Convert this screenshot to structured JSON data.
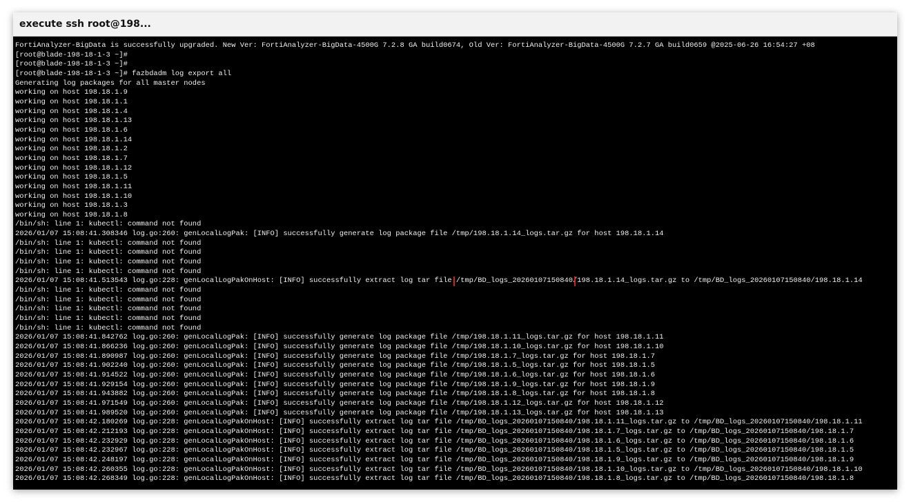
{
  "window": {
    "title": "execute ssh root@198..."
  },
  "terminal": {
    "lines": [
      "FortiAnalyzer-BigData is successfully upgraded. New Ver: FortiAnalyzer-BigData-4500G 7.2.8 GA build0674, Old Ver: FortiAnalyzer-BigData-4500G 7.2.7 GA build0659 @2025-06-26 16:54:27 +08",
      "[root@blade-198-18-1-3 ~]#",
      "[root@blade-198-18-1-3 ~]#",
      "[root@blade-198-18-1-3 ~]# fazbdadm log export all",
      "Generating log packages for all master nodes",
      "working on host 198.18.1.9",
      "working on host 198.18.1.1",
      "working on host 198.18.1.4",
      "working on host 198.18.1.13",
      "working on host 198.18.1.6",
      "working on host 198.18.1.14",
      "working on host 198.18.1.2",
      "working on host 198.18.1.7",
      "working on host 198.18.1.12",
      "working on host 198.18.1.5",
      "working on host 198.18.1.11",
      "working on host 198.18.1.10",
      "working on host 198.18.1.3",
      "working on host 198.18.1.8",
      "/bin/sh: line 1: kubectl: command not found",
      "2026/01/07 15:08:41.308346 log.go:260: genLocalLogPak: [INFO] successfully generate log package file /tmp/198.18.1.14_logs.tar.gz for host 198.18.1.14",
      "/bin/sh: line 1: kubectl: command not found",
      "/bin/sh: line 1: kubectl: command not found",
      "/bin/sh: line 1: kubectl: command not found",
      "/bin/sh: line 1: kubectl: command not found",
      "/bin/sh: line 1: kubectl: command not found",
      "/bin/sh: line 1: kubectl: command not found",
      "/bin/sh: line 1: kubectl: command not found",
      "/bin/sh: line 1: kubectl: command not found",
      "/bin/sh: line 1: kubectl: command not found",
      "2026/01/07 15:08:41.842762 log.go:260: genLocalLogPak: [INFO] successfully generate log package file /tmp/198.18.1.11_logs.tar.gz for host 198.18.1.11",
      "2026/01/07 15:08:41.866236 log.go:260: genLocalLogPak: [INFO] successfully generate log package file /tmp/198.18.1.10_logs.tar.gz for host 198.18.1.10",
      "2026/01/07 15:08:41.890987 log.go:260: genLocalLogPak: [INFO] successfully generate log package file /tmp/198.18.1.7_logs.tar.gz for host 198.18.1.7",
      "2026/01/07 15:08:41.902240 log.go:260: genLocalLogPak: [INFO] successfully generate log package file /tmp/198.18.1.5_logs.tar.gz for host 198.18.1.5",
      "2026/01/07 15:08:41.914522 log.go:260: genLocalLogPak: [INFO] successfully generate log package file /tmp/198.18.1.6_logs.tar.gz for host 198.18.1.6",
      "2026/01/07 15:08:41.929154 log.go:260: genLocalLogPak: [INFO] successfully generate log package file /tmp/198.18.1.9_logs.tar.gz for host 198.18.1.9",
      "2026/01/07 15:08:41.943882 log.go:260: genLocalLogPak: [INFO] successfully generate log package file /tmp/198.18.1.8_logs.tar.gz for host 198.18.1.8",
      "2026/01/07 15:08:41.971549 log.go:260: genLocalLogPak: [INFO] successfully generate log package file /tmp/198.18.1.12_logs.tar.gz for host 198.18.1.12",
      "2026/01/07 15:08:41.989520 log.go:260: genLocalLogPak: [INFO] successfully generate log package file /tmp/198.18.1.13_logs.tar.gz for host 198.18.1.13",
      "2026/01/07 15:08:42.180269 log.go:228: genLocalLogPakOnHost: [INFO] successfully extract log tar file /tmp/BD_logs_20260107150840/198.18.1.11_logs.tar.gz to /tmp/BD_logs_20260107150840/198.18.1.11",
      "2026/01/07 15:08:42.212193 log.go:228: genLocalLogPakOnHost: [INFO] successfully extract log tar file /tmp/BD_logs_20260107150840/198.18.1.7_logs.tar.gz to /tmp/BD_logs_20260107150840/198.18.1.7",
      "2026/01/07 15:08:42.232929 log.go:228: genLocalLogPakOnHost: [INFO] successfully extract log tar file /tmp/BD_logs_20260107150840/198.18.1.6_logs.tar.gz to /tmp/BD_logs_20260107150840/198.18.1.6",
      "2026/01/07 15:08:42.232967 log.go:228: genLocalLogPakOnHost: [INFO] successfully extract log tar file /tmp/BD_logs_20260107150840/198.18.1.5_logs.tar.gz to /tmp/BD_logs_20260107150840/198.18.1.5",
      "2026/01/07 15:08:42.248197 log.go:228: genLocalLogPakOnHost: [INFO] successfully extract log tar file /tmp/BD_logs_20260107150840/198.18.1.9_logs.tar.gz to /tmp/BD_logs_20260107150840/198.18.1.9",
      "2026/01/07 15:08:42.260355 log.go:228: genLocalLogPakOnHost: [INFO] successfully extract log tar file /tmp/BD_logs_20260107150840/198.18.1.10_logs.tar.gz to /tmp/BD_logs_20260107150840/198.18.1.10",
      "2026/01/07 15:08:42.268349 log.go:228: genLocalLogPakOnHost: [INFO] successfully extract log tar file /tmp/BD_logs_20260107150840/198.18.1.8_logs.tar.gz to /tmp/BD_logs_20260107150840/198.18.1.8"
    ],
    "highlight_line": {
      "prefix": "2026/01/07 15:08:41.513543 log.go:228: genLocalLogPakOnHost: [INFO] successfully extract log tar file ",
      "highlighted": "/tmp/BD_logs_20260107150840",
      "suffix": "/198.18.1.14_logs.tar.gz to /tmp/BD_logs_20260107150840/198.18.1.14"
    }
  },
  "colors": {
    "terminal_bg": "#000000",
    "terminal_fg": "#f0f0f0",
    "highlight_box": "#d21f1f"
  }
}
